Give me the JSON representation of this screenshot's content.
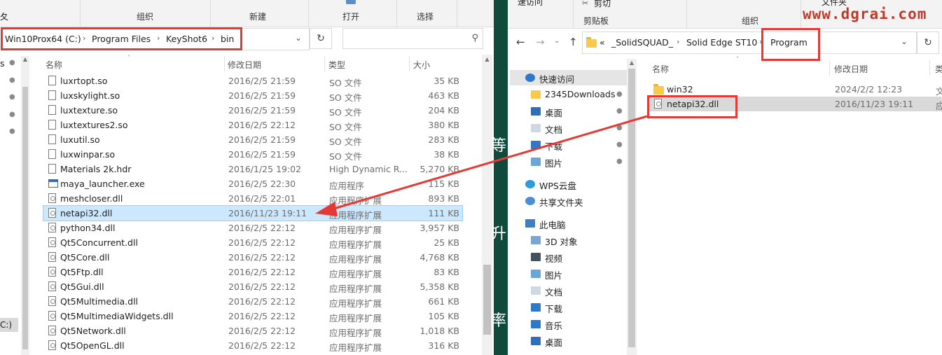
{
  "watermark": "www.dgrai.com",
  "left": {
    "ribbon": {
      "partial_left": "夂",
      "groups": [
        "组织",
        "新建",
        "打开",
        "选择"
      ]
    },
    "breadcrumb": [
      "Win10Prox64 (C:)",
      "Program Files",
      "KeyShot6",
      "bin"
    ],
    "columns": {
      "name": "名称",
      "date": "修改日期",
      "type": "类型",
      "size": "大小"
    },
    "files": [
      {
        "name": "luxrtopt.so",
        "date": "2016/2/5 21:59",
        "type": "SO 文件",
        "size": "35 KB",
        "icon": "file"
      },
      {
        "name": "luxskylight.so",
        "date": "2016/2/5 21:59",
        "type": "SO 文件",
        "size": "463 KB",
        "icon": "file"
      },
      {
        "name": "luxtexture.so",
        "date": "2016/2/5 21:59",
        "type": "SO 文件",
        "size": "204 KB",
        "icon": "file"
      },
      {
        "name": "luxtextures2.so",
        "date": "2016/2/5 22:12",
        "type": "SO 文件",
        "size": "380 KB",
        "icon": "file"
      },
      {
        "name": "luxutil.so",
        "date": "2016/2/5 21:59",
        "type": "SO 文件",
        "size": "283 KB",
        "icon": "file"
      },
      {
        "name": "luxwinpar.so",
        "date": "2016/2/5 21:59",
        "type": "SO 文件",
        "size": "38 KB",
        "icon": "file"
      },
      {
        "name": "Materials 2k.hdr",
        "date": "2016/1/25 19:02",
        "type": "High Dynamic R...",
        "size": "5,270 KB",
        "icon": "file"
      },
      {
        "name": "maya_launcher.exe",
        "date": "2016/2/5 22:30",
        "type": "应用程序",
        "size": "115 KB",
        "icon": "exe"
      },
      {
        "name": "meshcloser.dll",
        "date": "2016/2/5 22:01",
        "type": "应用程序扩展",
        "size": "893 KB",
        "icon": "dll"
      },
      {
        "name": "netapi32.dll",
        "date": "2016/11/23 19:11",
        "type": "应用程序扩展",
        "size": "111 KB",
        "icon": "dll",
        "selected": true
      },
      {
        "name": "python34.dll",
        "date": "2016/2/5 22:12",
        "type": "应用程序扩展",
        "size": "3,957 KB",
        "icon": "dll"
      },
      {
        "name": "Qt5Concurrent.dll",
        "date": "2016/2/5 22:12",
        "type": "应用程序扩展",
        "size": "25 KB",
        "icon": "dll"
      },
      {
        "name": "Qt5Core.dll",
        "date": "2016/2/5 22:12",
        "type": "应用程序扩展",
        "size": "4,768 KB",
        "icon": "dll"
      },
      {
        "name": "Qt5Ftp.dll",
        "date": "2016/2/5 22:12",
        "type": "应用程序扩展",
        "size": "83 KB",
        "icon": "dll"
      },
      {
        "name": "Qt5Gui.dll",
        "date": "2016/2/5 22:12",
        "type": "应用程序扩展",
        "size": "5,358 KB",
        "icon": "dll"
      },
      {
        "name": "Qt5Multimedia.dll",
        "date": "2016/2/5 22:12",
        "type": "应用程序扩展",
        "size": "661 KB",
        "icon": "dll"
      },
      {
        "name": "Qt5MultimediaWidgets.dll",
        "date": "2016/2/5 22:12",
        "type": "应用程序扩展",
        "size": "105 KB",
        "icon": "dll"
      },
      {
        "name": "Qt5Network.dll",
        "date": "2016/2/5 22:12",
        "type": "应用程序扩展",
        "size": "1,018 KB",
        "icon": "dll"
      },
      {
        "name": "Qt5OpenGL.dll",
        "date": "2016/2/5 22:12",
        "type": "应用程序扩展",
        "size": "316 KB",
        "icon": "dll"
      }
    ],
    "nav_partial": {
      "s_label": "s",
      "drive_label": "C:)"
    }
  },
  "middle": {
    "chars": [
      "等",
      "升",
      "率"
    ]
  },
  "right": {
    "ribbon": {
      "top_items": [
        "速访问",
        "剪切",
        "文件夹"
      ],
      "groups": [
        "剪贴板",
        "组织"
      ]
    },
    "breadcrumb": [
      "«",
      "_SolidSQUAD_",
      "Solid Edge ST10",
      "Program"
    ],
    "columns": {
      "name": "名称",
      "date": "修改日期",
      "type": "类"
    },
    "files": [
      {
        "name": "win32",
        "date": "2024/2/2 12:23",
        "type": "文",
        "icon": "folder"
      },
      {
        "name": "netapi32.dll",
        "date": "2016/11/23 19:11",
        "type": "应",
        "icon": "dll",
        "selected": true
      }
    ],
    "nav": [
      {
        "label": "快速访问",
        "icon": "star-icon",
        "pinned": false
      },
      {
        "label": "2345Downloads",
        "icon": "folder-icon",
        "pinned": true
      },
      {
        "label": "桌面",
        "icon": "desktop-icon",
        "pinned": true
      },
      {
        "label": "文档",
        "icon": "document-icon",
        "pinned": true
      },
      {
        "label": "下载",
        "icon": "download-icon",
        "pinned": true
      },
      {
        "label": "图片",
        "icon": "picture-icon",
        "pinned": true
      },
      {
        "label": "WPS云盘",
        "icon": "cloud-icon",
        "pinned": false
      },
      {
        "label": "共享文件夹",
        "icon": "share-icon",
        "pinned": false
      },
      {
        "label": "此电脑",
        "icon": "computer-icon",
        "pinned": false
      },
      {
        "label": "3D 对象",
        "icon": "cube-icon",
        "pinned": false
      },
      {
        "label": "视频",
        "icon": "video-icon",
        "pinned": false
      },
      {
        "label": "图片",
        "icon": "picture-icon",
        "pinned": false
      },
      {
        "label": "文档",
        "icon": "document-icon",
        "pinned": false
      },
      {
        "label": "下载",
        "icon": "download-icon",
        "pinned": false
      },
      {
        "label": "音乐",
        "icon": "music-icon",
        "pinned": false
      },
      {
        "label": "桌面",
        "icon": "desktop-icon",
        "pinned": false
      }
    ]
  },
  "colors": {
    "annotation_red": "#e53935",
    "selection": "#cce8ff",
    "greenband": "#0f4a3a"
  }
}
